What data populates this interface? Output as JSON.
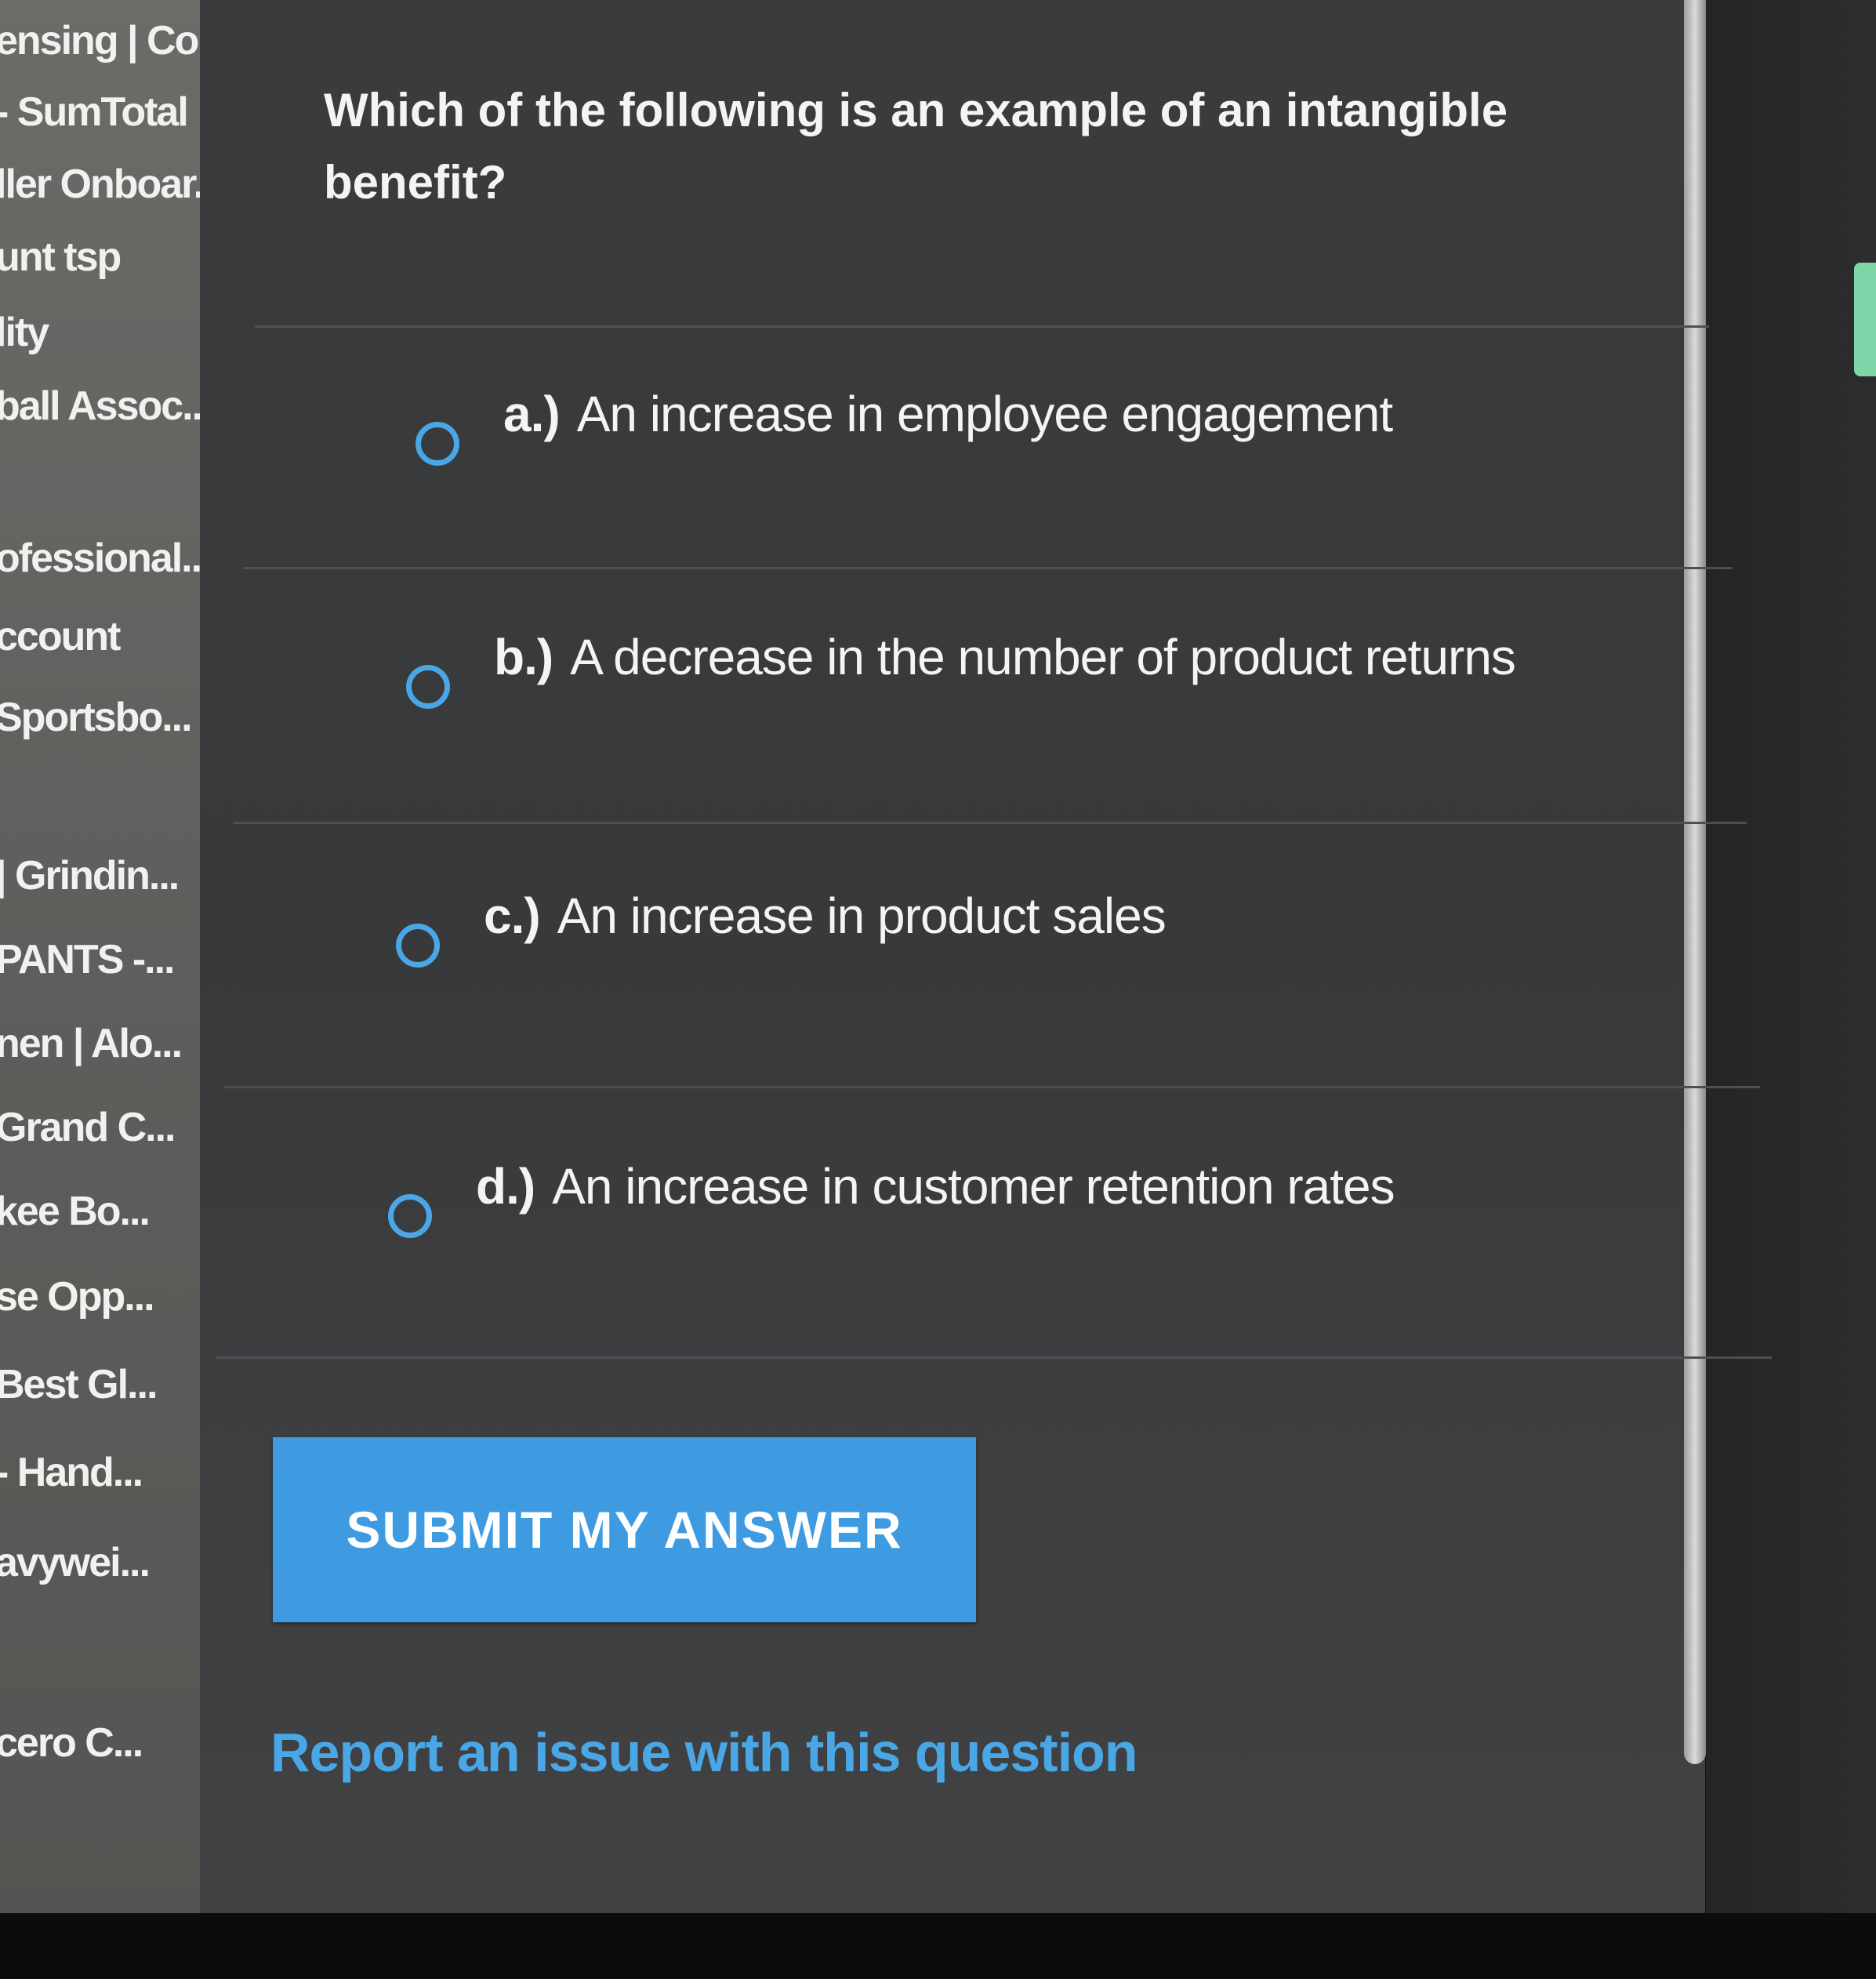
{
  "sidebar": {
    "items": [
      {
        "label": "ensing | Co..."
      },
      {
        "label": "- SumTotal"
      },
      {
        "label": "ller Onboar..."
      },
      {
        "label": "unt tsp"
      },
      {
        "label": "lity"
      },
      {
        "label": "ball Assoc..."
      },
      {
        "label": "ofessional..."
      },
      {
        "label": "ccount"
      },
      {
        "label": "Sportsbo..."
      },
      {
        "label": "| Grindin..."
      },
      {
        "label": "PANTS -..."
      },
      {
        "label": "nen | Alo..."
      },
      {
        "label": "Grand C..."
      },
      {
        "label": "kee Bo..."
      },
      {
        "label": "se Opp..."
      },
      {
        "label": "Best Gl..."
      },
      {
        "label": "- Hand..."
      },
      {
        "label": "avywei..."
      },
      {
        "label": "cero C..."
      }
    ]
  },
  "quiz": {
    "question": "Which of the following is an example of an intangible benefit?",
    "answers": [
      {
        "letter": "a.)",
        "text": "An increase in employee engagement"
      },
      {
        "letter": "b.)",
        "text": "A decrease in the number of product returns"
      },
      {
        "letter": "c.)",
        "text": "An increase in product sales"
      },
      {
        "letter": "d.)",
        "text": "An increase in customer retention rates"
      }
    ],
    "submit_label": "SUBMIT MY ANSWER",
    "report_link": "Report an issue with this question"
  },
  "colors": {
    "accent": "#3e9be2",
    "radio": "#4aa7e6",
    "panel": "#3a3b3d",
    "sidebar": "#62625f"
  }
}
